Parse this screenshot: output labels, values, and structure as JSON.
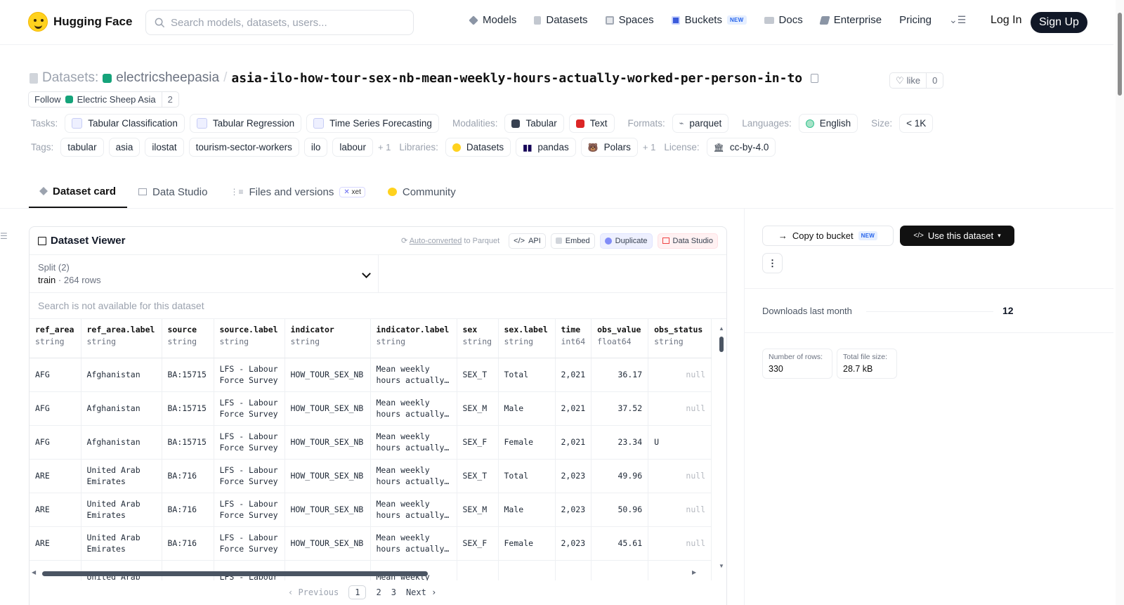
{
  "header": {
    "brand": "Hugging Face",
    "search_placeholder": "Search models, datasets, users...",
    "nav": [
      {
        "label": "Models",
        "icon": "models-icon",
        "color": "#6b7280"
      },
      {
        "label": "Datasets",
        "icon": "datasets-icon",
        "color": "#9ca3af"
      },
      {
        "label": "Spaces",
        "icon": "spaces-icon",
        "color": "#9ca3af"
      },
      {
        "label": "Buckets",
        "icon": "buckets-icon",
        "color": "#3b5bdb",
        "badge": "NEW"
      },
      {
        "label": "Docs",
        "icon": "docs-icon",
        "color": "#9ca3af"
      },
      {
        "label": "Enterprise",
        "icon": "enterprise-icon",
        "color": "#6b7280"
      },
      {
        "label": "Pricing"
      }
    ],
    "login": "Log In",
    "signup": "Sign Up"
  },
  "dataset": {
    "section": "Datasets:",
    "org": "electricsheepasia",
    "name": "asia-ilo-how-tour-sex-nb-mean-weekly-hours-actually-worked-per-person-in-to",
    "like_label": "like",
    "like_count": "0",
    "follow_label": "Follow",
    "follow_org": "Electric Sheep Asia",
    "follow_count": "2"
  },
  "meta_row1": {
    "tasks_label": "Tasks:",
    "tasks": [
      "Tabular Classification",
      "Tabular Regression",
      "Time Series Forecasting"
    ],
    "modalities_label": "Modalities:",
    "modalities": [
      "Tabular",
      "Text"
    ],
    "formats_label": "Formats:",
    "formats": [
      "parquet"
    ],
    "languages_label": "Languages:",
    "languages": [
      "English"
    ],
    "size_label": "Size:",
    "size": "< 1K"
  },
  "meta_row2": {
    "tags_label": "Tags:",
    "tags": [
      "tabular",
      "asia",
      "ilostat",
      "tourism-sector-workers",
      "ilo",
      "labour"
    ],
    "tags_more": "+ 1",
    "libraries_label": "Libraries:",
    "libraries": [
      "Datasets",
      "pandas",
      "Polars"
    ],
    "libraries_more": "+ 1",
    "license_label": "License:",
    "license": "cc-by-4.0"
  },
  "tabs": [
    {
      "label": "Dataset card",
      "active": true
    },
    {
      "label": "Data Studio"
    },
    {
      "label": "Files and versions",
      "badge": "xet"
    },
    {
      "label": "Community"
    }
  ],
  "viewer": {
    "title": "Dataset Viewer",
    "auto_link": "Auto-converted",
    "auto_rest": "to Parquet",
    "actions": [
      "API",
      "Embed",
      "Duplicate",
      "Data Studio"
    ],
    "split_label": "Split (2)",
    "split_name": "train",
    "split_rows": "264 rows",
    "search_na": "Search is not available for this dataset",
    "columns": [
      {
        "name": "ref_area",
        "type": "string"
      },
      {
        "name": "ref_area.label",
        "type": "string"
      },
      {
        "name": "source",
        "type": "string"
      },
      {
        "name": "source.label",
        "type": "string"
      },
      {
        "name": "indicator",
        "type": "string"
      },
      {
        "name": "indicator.label",
        "type": "string"
      },
      {
        "name": "sex",
        "type": "string"
      },
      {
        "name": "sex.label",
        "type": "string"
      },
      {
        "name": "time",
        "type": "int64"
      },
      {
        "name": "obs_value",
        "type": "float64"
      },
      {
        "name": "obs_status",
        "type": "string"
      }
    ],
    "rows": [
      [
        "AFG",
        "Afghanistan",
        "BA:15715",
        "LFS - Labour Force Survey",
        "HOW_TOUR_SEX_NB",
        "Mean weekly hours actually…",
        "SEX_T",
        "Total",
        "2,021",
        "36.17",
        "null"
      ],
      [
        "AFG",
        "Afghanistan",
        "BA:15715",
        "LFS - Labour Force Survey",
        "HOW_TOUR_SEX_NB",
        "Mean weekly hours actually…",
        "SEX_M",
        "Male",
        "2,021",
        "37.52",
        "null"
      ],
      [
        "AFG",
        "Afghanistan",
        "BA:15715",
        "LFS - Labour Force Survey",
        "HOW_TOUR_SEX_NB",
        "Mean weekly hours actually…",
        "SEX_F",
        "Female",
        "2,021",
        "23.34",
        "U"
      ],
      [
        "ARE",
        "United Arab Emirates",
        "BA:716",
        "LFS - Labour Force Survey",
        "HOW_TOUR_SEX_NB",
        "Mean weekly hours actually…",
        "SEX_T",
        "Total",
        "2,023",
        "49.96",
        "null"
      ],
      [
        "ARE",
        "United Arab Emirates",
        "BA:716",
        "LFS - Labour Force Survey",
        "HOW_TOUR_SEX_NB",
        "Mean weekly hours actually…",
        "SEX_M",
        "Male",
        "2,023",
        "50.96",
        "null"
      ],
      [
        "ARE",
        "United Arab Emirates",
        "BA:716",
        "LFS - Labour Force Survey",
        "HOW_TOUR_SEX_NB",
        "Mean weekly hours actually…",
        "SEX_F",
        "Female",
        "2,023",
        "45.61",
        "null"
      ],
      [
        "",
        "United Arab",
        "",
        "LFS - Labour",
        "",
        "Mean weekly",
        "",
        "",
        "",
        "",
        ""
      ]
    ],
    "pager": {
      "prev": "Previous",
      "pages": [
        "1",
        "2",
        "3"
      ],
      "next": "Next"
    }
  },
  "sidebar": {
    "copy_bucket": "Copy to bucket",
    "copy_badge": "NEW",
    "use_dataset": "Use this dataset",
    "more": "⋮",
    "downloads_label": "Downloads last month",
    "downloads_value": "12",
    "rows_label": "Number of rows:",
    "rows_value": "330",
    "size_label": "Total file size:",
    "size_value": "28.7 kB"
  }
}
